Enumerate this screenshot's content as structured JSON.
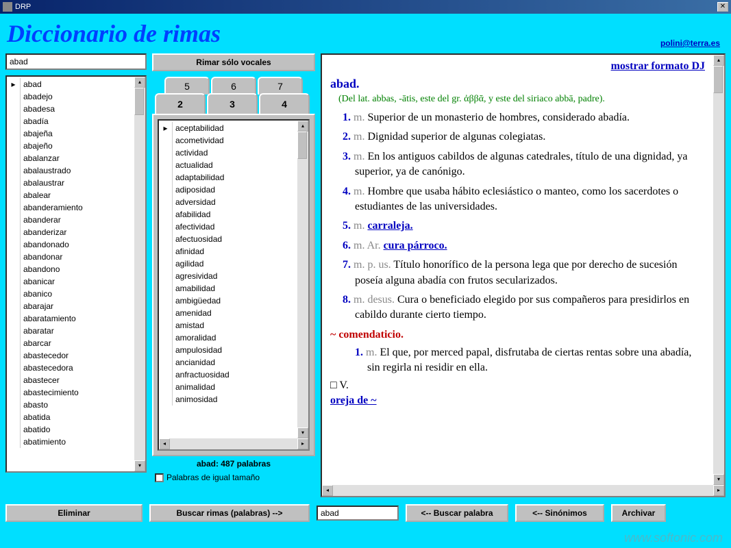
{
  "window": {
    "title": "DRP"
  },
  "header": {
    "title": "Diccionario de rimas",
    "contact": "polini@terra.es"
  },
  "search": {
    "value": "abad"
  },
  "buttons": {
    "rimar_vocales": "Rimar sólo vocales",
    "eliminar": "Eliminar",
    "buscar_rimas": "Buscar rimas (palabras) -->",
    "buscar_palabra": "<-- Buscar palabra",
    "sinonimos": "<-- Sinónimos",
    "archivar": "Archivar"
  },
  "tabs_back": [
    "5",
    "6",
    "7"
  ],
  "tabs_front": [
    "2",
    "3",
    "4"
  ],
  "wordlist": [
    "abad",
    "abadejo",
    "abadesa",
    "abadía",
    "abajeña",
    "abajeño",
    "abalanzar",
    "abalaustrado",
    "abalaustrar",
    "abalear",
    "abanderamiento",
    "abanderar",
    "abanderizar",
    "abandonado",
    "abandonar",
    "abandono",
    "abanicar",
    "abanico",
    "abarajar",
    "abaratamiento",
    "abaratar",
    "abarcar",
    "abastecedor",
    "abastecedora",
    "abastecer",
    "abastecimiento",
    "abasto",
    "abatida",
    "abatido",
    "abatimiento"
  ],
  "rhymelist": [
    "aceptabilidad",
    "acometividad",
    "actividad",
    "actualidad",
    "adaptabilidad",
    "adiposidad",
    "adversidad",
    "afabilidad",
    "afectividad",
    "afectuosidad",
    "afinidad",
    "agilidad",
    "agresividad",
    "amabilidad",
    "ambigüedad",
    "amenidad",
    "amistad",
    "amoralidad",
    "ampulosidad",
    "ancianidad",
    "anfractuosidad",
    "animalidad",
    "animosidad"
  ],
  "status": {
    "count": "abad: 487 palabras",
    "checkbox_label": "Palabras de igual tamaño"
  },
  "definition": {
    "format_link": "mostrar formato DJ",
    "headword": "abad.",
    "etymology": "(Del lat. abbas, -ātis, este del gr. ἀββᾶ, y este del siriaco abbā, padre).",
    "entries": [
      {
        "n": "1.",
        "pos": "m.",
        "text": "Superior de un monasterio de hombres, considerado abadía."
      },
      {
        "n": "2.",
        "pos": "m.",
        "text": "Dignidad superior de algunas colegiatas."
      },
      {
        "n": "3.",
        "pos": "m.",
        "text": "En los antiguos cabildos de algunas catedrales, título de una dignidad, ya superior, ya de canónigo."
      },
      {
        "n": "4.",
        "pos": "m.",
        "text": "Hombre que usaba hábito eclesiástico o manteo, como los sacerdotes o estudiantes de las universidades."
      },
      {
        "n": "5.",
        "pos": "m.",
        "xref": "carraleja."
      },
      {
        "n": "6.",
        "pos": "m. Ar.",
        "xref": "cura párroco."
      },
      {
        "n": "7.",
        "pos": "m. p. us.",
        "text": "Título honorífico de la persona lega que por derecho de sucesión poseía alguna abadía con frutos secularizados."
      },
      {
        "n": "8.",
        "pos": "m. desus.",
        "text": "Cura o beneficiado elegido por sus compañeros para presidirlos en cabildo durante cierto tiempo."
      }
    ],
    "sub": "~ comendaticio.",
    "sub_entries": [
      {
        "n": "1.",
        "pos": "m.",
        "text": "El que, por merced papal, disfrutaba de ciertas rentas sobre una abadía, sin regirla ni residir en ella."
      }
    ],
    "vsection": "□ V.",
    "seealso": "oreja de ~"
  },
  "bottom_search": {
    "value": "abad"
  },
  "watermark": "www.softonic.com"
}
